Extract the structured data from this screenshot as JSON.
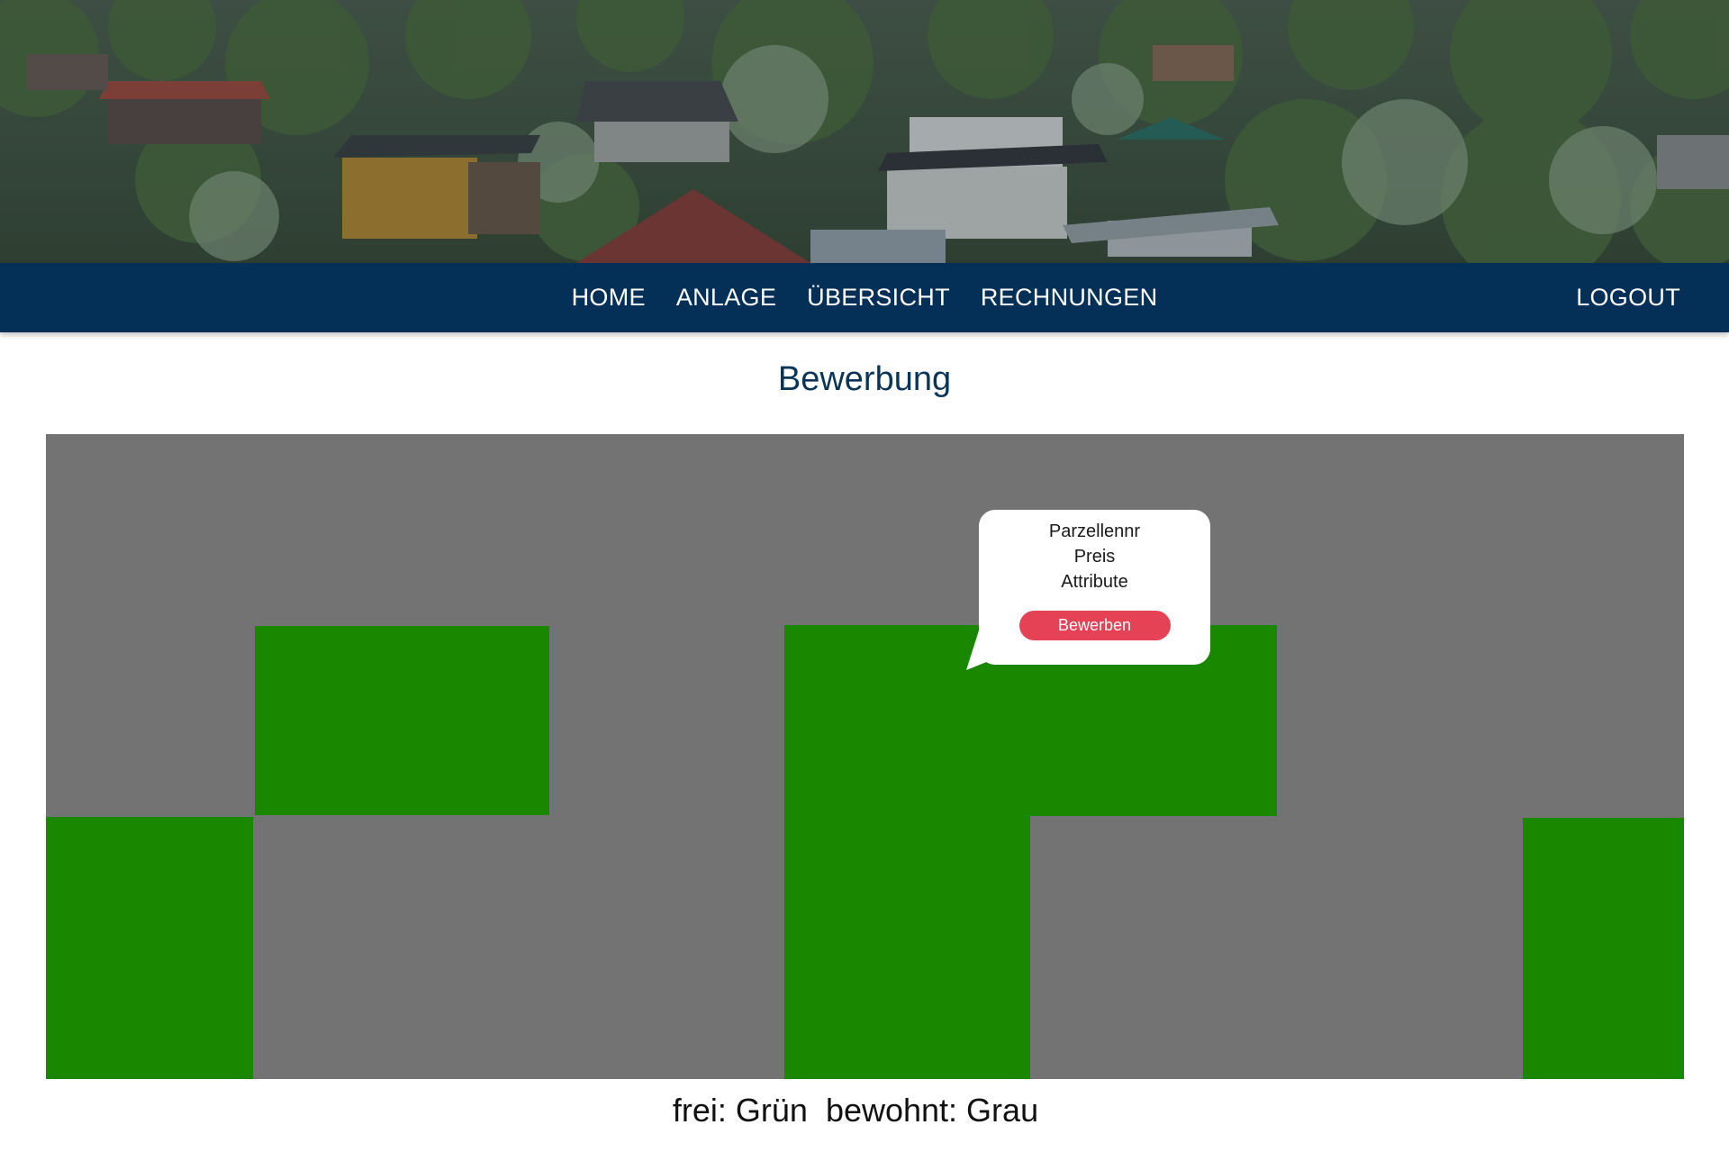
{
  "nav": {
    "links": [
      "HOME",
      "ANLAGE",
      "ÜBERSICHT",
      "RECHNUNGEN"
    ],
    "logout": "LOGOUT"
  },
  "page": {
    "title": "Bewerbung"
  },
  "map": {
    "colors": {
      "free": "#198700",
      "occupied": "#737373"
    }
  },
  "popup": {
    "lines": [
      "Parzellennr",
      "Preis",
      "Attribute"
    ],
    "button": "Bewerben"
  },
  "legend": {
    "text": "frei: Grün  bewohnt: Grau"
  },
  "theme": {
    "navbar": "#042f56",
    "accent": "#e54255",
    "title": "#0b3558"
  }
}
